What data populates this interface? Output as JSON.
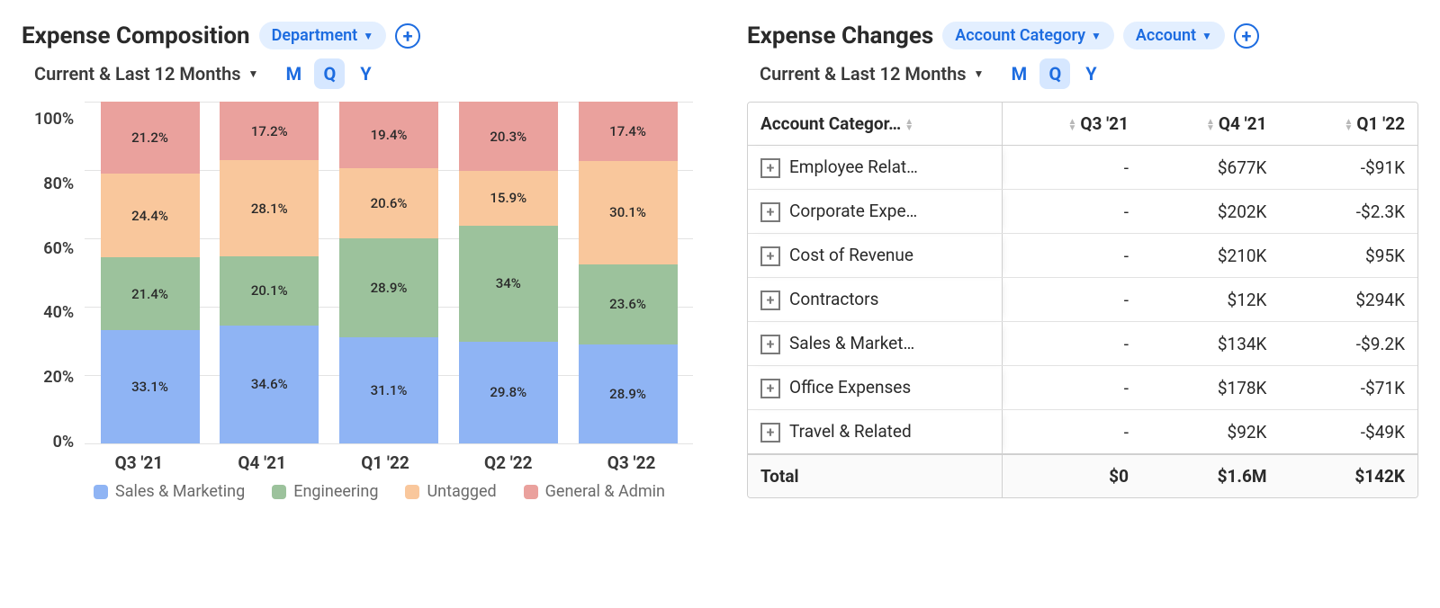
{
  "left": {
    "title": "Expense Composition",
    "chip": "Department",
    "period": "Current & Last 12 Months",
    "gran": {
      "m": "M",
      "q": "Q",
      "y": "Y",
      "active": "q"
    }
  },
  "right": {
    "title": "Expense Changes",
    "chip1": "Account Category",
    "chip2": "Account",
    "period": "Current & Last 12 Months",
    "gran": {
      "m": "M",
      "q": "Q",
      "y": "Y",
      "active": "q"
    }
  },
  "chart_data": {
    "type": "stacked-bar-100",
    "ylabel": "",
    "xlabel": "",
    "ylim": [
      0,
      100
    ],
    "y_ticks": [
      "100%",
      "80%",
      "60%",
      "40%",
      "20%",
      "0%"
    ],
    "categories": [
      "Q3 '21",
      "Q4 '21",
      "Q1 '22",
      "Q2 '22",
      "Q3 '22"
    ],
    "series": [
      {
        "name": "Sales & Marketing",
        "color": "#8fb4f4",
        "values": [
          33.1,
          34.6,
          31.1,
          29.8,
          28.9
        ]
      },
      {
        "name": "Engineering",
        "color": "#9cc29c",
        "values": [
          21.4,
          20.1,
          28.9,
          34.0,
          23.6
        ]
      },
      {
        "name": "Untagged",
        "color": "#f9c79c",
        "values": [
          24.4,
          28.1,
          20.6,
          15.9,
          30.1
        ]
      },
      {
        "name": "General & Admin",
        "color": "#eaa19d",
        "values": [
          21.2,
          17.2,
          19.4,
          20.3,
          17.4
        ]
      }
    ],
    "labels": [
      [
        "33.1%",
        "21.4%",
        "24.4%",
        "21.2%"
      ],
      [
        "34.6%",
        "20.1%",
        "28.1%",
        "17.2%"
      ],
      [
        "31.1%",
        "28.9%",
        "20.6%",
        "19.4%"
      ],
      [
        "29.8%",
        "34%",
        "15.9%",
        "20.3%"
      ],
      [
        "28.9%",
        "23.6%",
        "30.1%",
        "17.4%"
      ]
    ]
  },
  "table": {
    "col0": "Account Categor…",
    "cols": [
      "Q3 '21",
      "Q4 '21",
      "Q1 '22"
    ],
    "rows": [
      {
        "name": "Employee Relat…",
        "c": [
          "-",
          "$677K",
          "-$91K"
        ]
      },
      {
        "name": "Corporate Expe…",
        "c": [
          "-",
          "$202K",
          "-$2.3K"
        ]
      },
      {
        "name": "Cost of Revenue",
        "c": [
          "-",
          "$210K",
          "$95K"
        ]
      },
      {
        "name": "Contractors",
        "c": [
          "-",
          "$12K",
          "$294K"
        ]
      },
      {
        "name": "Sales & Market…",
        "c": [
          "-",
          "$134K",
          "-$9.2K"
        ]
      },
      {
        "name": "Office Expenses",
        "c": [
          "-",
          "$178K",
          "-$71K"
        ]
      },
      {
        "name": "Travel & Related",
        "c": [
          "-",
          "$92K",
          "-$49K"
        ]
      }
    ],
    "total": {
      "name": "Total",
      "c": [
        "$0",
        "$1.6M",
        "$142K"
      ]
    }
  }
}
